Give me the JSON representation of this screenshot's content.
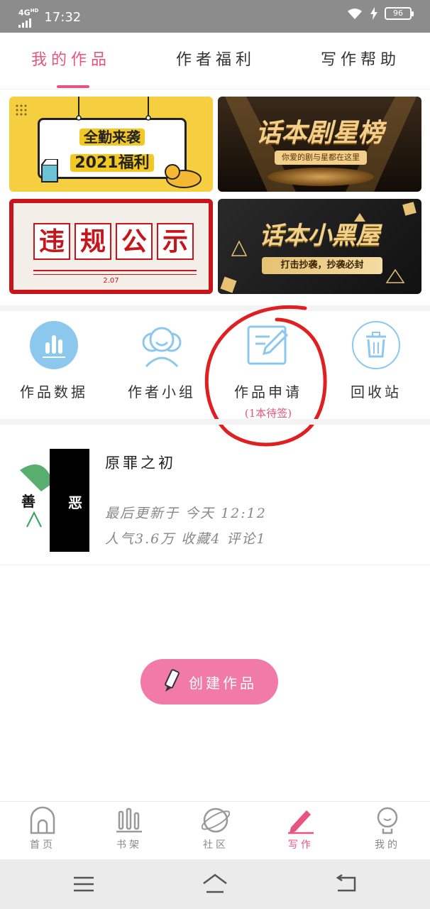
{
  "status_bar": {
    "network": "4G",
    "network_sup": "HD",
    "time": "17:32",
    "battery": "96"
  },
  "tabs": [
    {
      "label": "我的作品",
      "active": true
    },
    {
      "label": "作者福利",
      "active": false
    },
    {
      "label": "写作帮助",
      "active": false
    }
  ],
  "banners": {
    "b1": {
      "line1": "全勤来袭",
      "line2": "2021福利"
    },
    "b2": {
      "title": "话本剧星榜",
      "subtitle": "你爱的剧与星都在这里"
    },
    "b3": {
      "chars": [
        "违",
        "规",
        "公",
        "示"
      ],
      "date": "2.07"
    },
    "b4": {
      "title": "话本小黑屋",
      "subtitle": "打击抄袭，抄袭必封"
    }
  },
  "functions": [
    {
      "label": "作品数据",
      "icon": "bar-chart-icon"
    },
    {
      "label": "作者小组",
      "icon": "group-icon"
    },
    {
      "label": "作品申请",
      "sublabel": "(1本待签)",
      "icon": "edit-document-icon"
    },
    {
      "label": "回收站",
      "icon": "trash-icon"
    }
  ],
  "work": {
    "title": "原罪之初",
    "cover_left": "善",
    "cover_right": "恶",
    "updated": "最后更新于 今天 12:12",
    "stats": "人气3.6万 收藏4 评论1"
  },
  "create_button": {
    "label": "创建作品"
  },
  "bottom_nav": [
    {
      "label": "首页",
      "icon": "home-icon",
      "active": false
    },
    {
      "label": "书架",
      "icon": "bookshelf-icon",
      "active": false
    },
    {
      "label": "社区",
      "icon": "planet-icon",
      "active": false
    },
    {
      "label": "写作",
      "icon": "pencil-icon",
      "active": true
    },
    {
      "label": "我的",
      "icon": "profile-icon",
      "active": false
    }
  ],
  "colors": {
    "accent": "#e75480",
    "icon_blue": "#8cc8ee",
    "button_pink": "#f27aa9",
    "annotation_red": "#e02020"
  }
}
